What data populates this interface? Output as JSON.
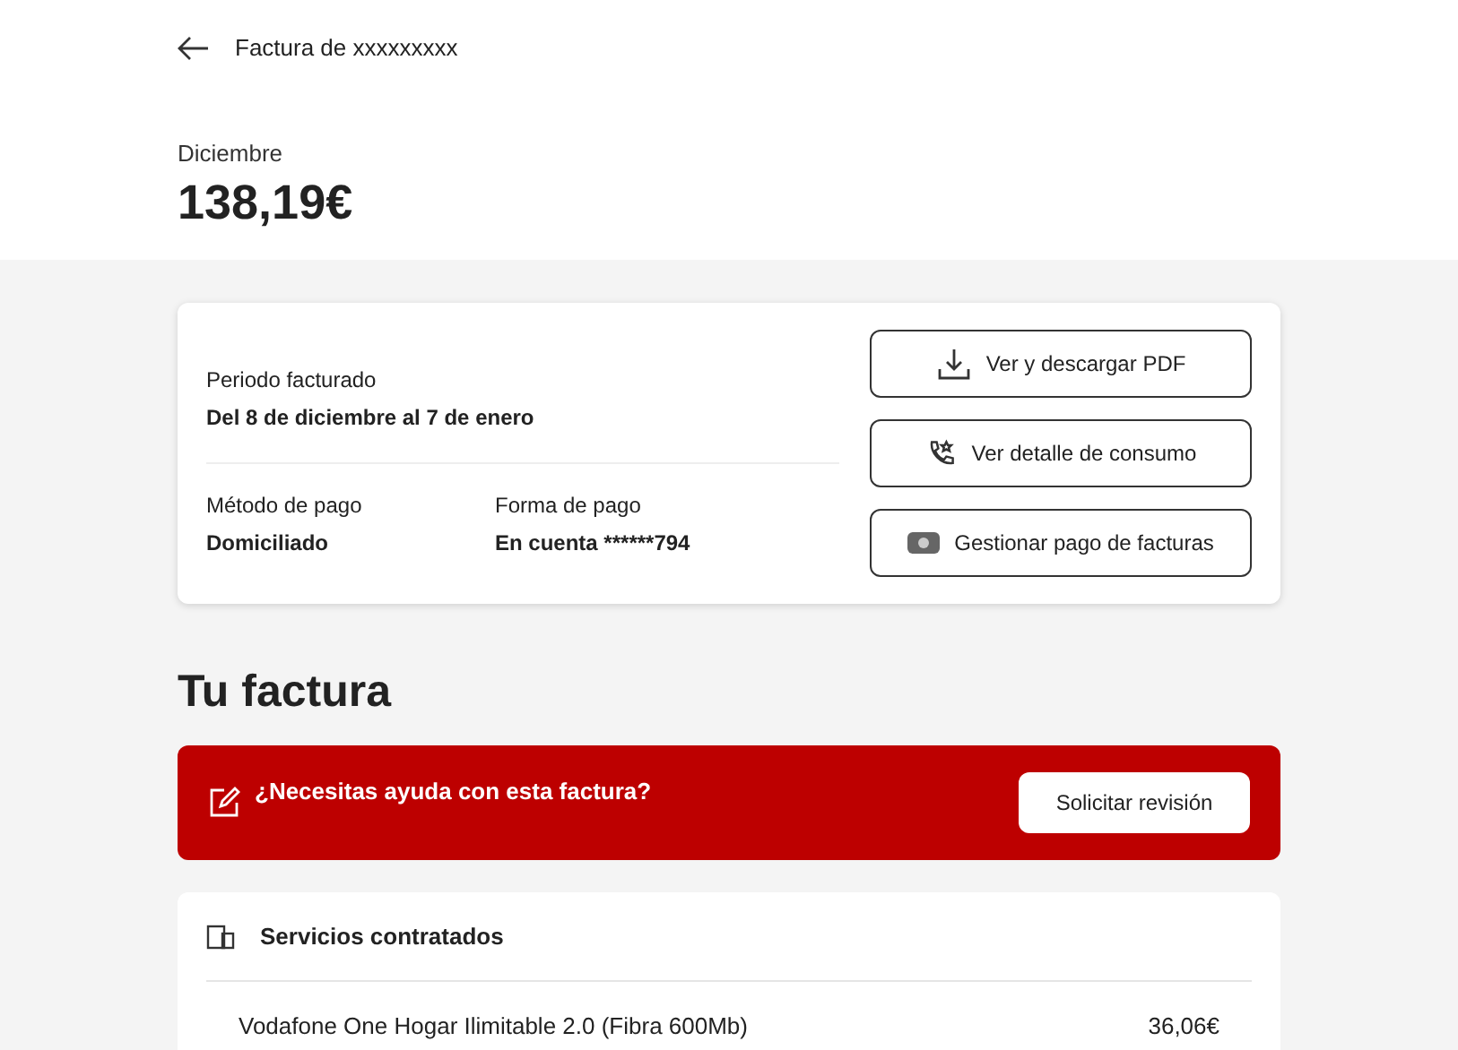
{
  "header": {
    "title": "Factura de xxxxxxxxx",
    "month": "Diciembre",
    "amount": "138,19€"
  },
  "summary": {
    "period": {
      "label": "Periodo facturado",
      "value": "Del 8 de diciembre al 7 de enero"
    },
    "fields": [
      {
        "label": "Método de pago",
        "value": "Domiciliado"
      },
      {
        "label": "Forma de pago",
        "value": "En cuenta ******794"
      }
    ],
    "actions": [
      {
        "kind": "download",
        "label": "Ver y descargar PDF"
      },
      {
        "kind": "phone",
        "label": "Ver detalle de consumo"
      },
      {
        "kind": "money",
        "label": "Gestionar pago de facturas"
      }
    ]
  },
  "section_title": "Tu factura",
  "help_banner": {
    "text": "¿Necesitas ayuda con esta factura?",
    "button": "Solicitar revisión"
  },
  "services": {
    "title": "Servicios contratados",
    "items": [
      {
        "name": "Vodafone One Hogar Ilimitable 2.0 (Fibra 600Mb)",
        "price": "36,06€"
      }
    ]
  }
}
